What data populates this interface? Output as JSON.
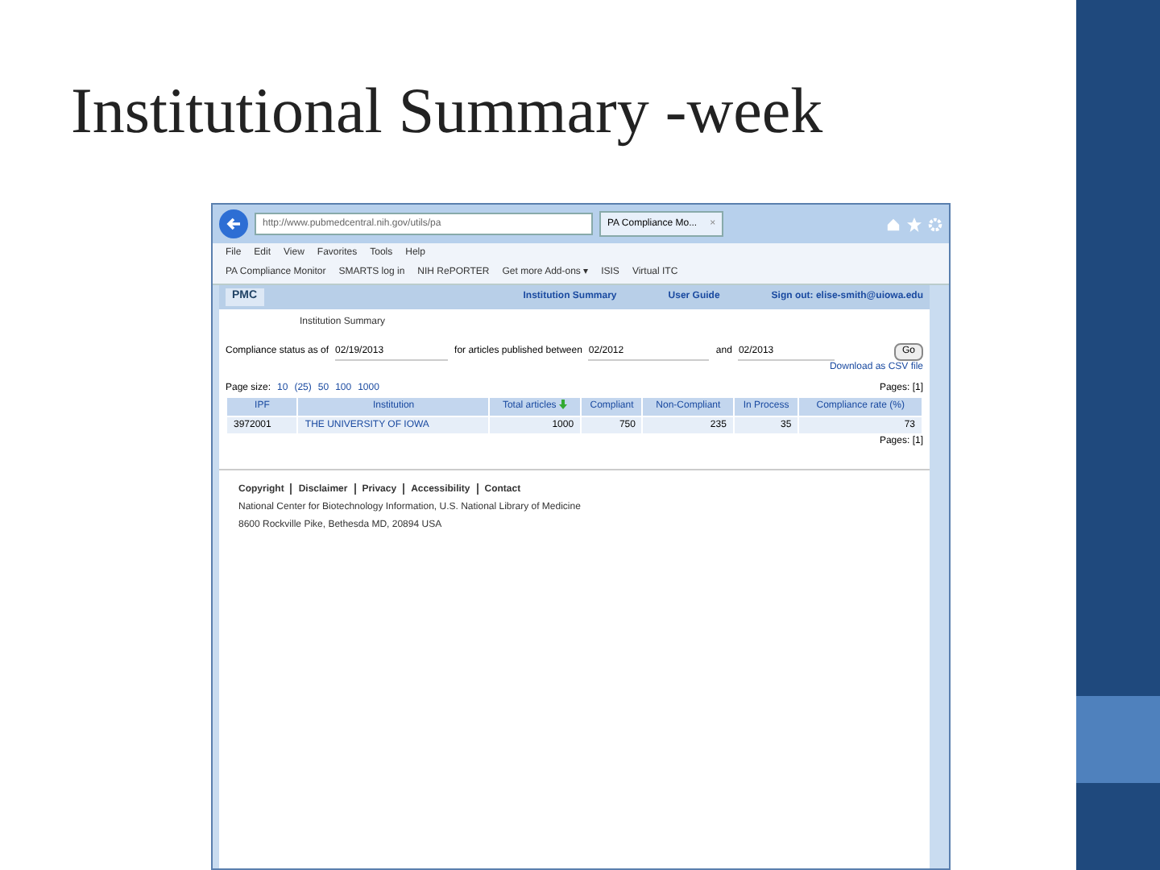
{
  "slide": {
    "title": "Institutional Summary -week"
  },
  "browser": {
    "address": "http://www.pubmedcentral.nih.gov/utils/pa",
    "tab": "PA Compliance Mo...",
    "tab_close": "×",
    "menu": [
      "File",
      "Edit",
      "View",
      "Favorites",
      "Tools",
      "Help"
    ],
    "favorites": [
      "PA Compliance Monitor",
      "SMARTS log in",
      "NIH RePORTER",
      "Get more Add-ons ▾",
      "ISIS",
      "Virtual ITC"
    ]
  },
  "page": {
    "logo": "PMC",
    "nav": [
      "Institution Summary",
      "User Guide",
      "Sign out: elise-smith@uiowa.edu"
    ],
    "heading": "Institution Summary",
    "form": {
      "status_label": "Compliance status as of",
      "status_value": "02/19/2013",
      "between_label": "for articles published between",
      "from_value": "02/2012",
      "and_label": "and",
      "to_value": "02/2013",
      "go": "Go",
      "download": "Download as CSV file"
    },
    "page_size_label": "Page size:",
    "page_sizes": [
      "10",
      "(25)",
      "50",
      "100",
      "1000"
    ],
    "pages_top": "Pages: [1]",
    "table": {
      "columns": [
        "IPF",
        "Institution",
        "Total articles",
        "Compliant",
        "Non-Compliant",
        "In Process",
        "Compliance rate (%)"
      ],
      "rows": [
        [
          "3972001",
          "THE UNIVERSITY OF IOWA",
          "1000",
          "750",
          "235",
          "35",
          "73"
        ]
      ]
    },
    "pages_bottom": "Pages: [1]",
    "footer_links": [
      "Copyright",
      "Disclaimer",
      "Privacy",
      "Accessibility",
      "Contact"
    ],
    "footer_lines": [
      "National Center for Biotechnology Information, U.S. National Library of Medicine",
      "8600 Rockville Pike, Bethesda MD, 20894 USA"
    ]
  }
}
